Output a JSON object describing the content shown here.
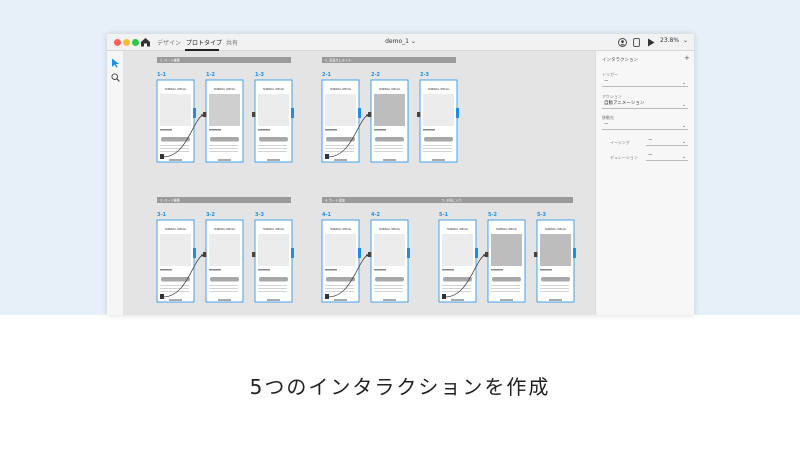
{
  "app": {
    "tabs": [
      {
        "label": "デザイン",
        "active": false
      },
      {
        "label": "プロトタイプ",
        "active": true
      },
      {
        "label": "共有",
        "active": false
      }
    ],
    "document_title": "demo_1 ⌄",
    "zoom": "23.8%"
  },
  "panel": {
    "title": "インタラクション",
    "add": "+",
    "trigger_label": "トリガー",
    "trigger_value": "ー",
    "action_label": "アクション",
    "action_value": "自動アニメーション",
    "destination_label": "移動先",
    "destination_value": "ー",
    "easing_label": "イージング",
    "easing_value": "ー",
    "duration_label": "デュレーション",
    "duration_value": "ー"
  },
  "groups": [
    {
      "header": "1. ページ遷移",
      "screens": [
        "1-1",
        "1-2",
        "1-3"
      ]
    },
    {
      "header": "2. 商品サムネイル",
      "screens": [
        "2-1",
        "2-2",
        "2-3"
      ]
    },
    {
      "header": "3. ページ遷移",
      "screens": [
        "3-1",
        "3-2",
        "3-3"
      ]
    },
    {
      "header": "4. カート追加",
      "screens": [
        "4-1",
        "4-2"
      ]
    },
    {
      "header": "5. お気に入り",
      "screens": [
        "5-1",
        "5-2",
        "5-3"
      ]
    }
  ],
  "screen_brand": "HANDBALL SPECIAL",
  "caption": "5つのインタラクションを作成",
  "colors": {
    "accent": "#1d8ee6",
    "canvas": "#e4e4e4",
    "header_bar": "#9a9a9a",
    "background": "#e7f0f8",
    "dot_red": "#ff5f57",
    "dot_yellow": "#febc2e",
    "dot_green": "#28c840"
  }
}
